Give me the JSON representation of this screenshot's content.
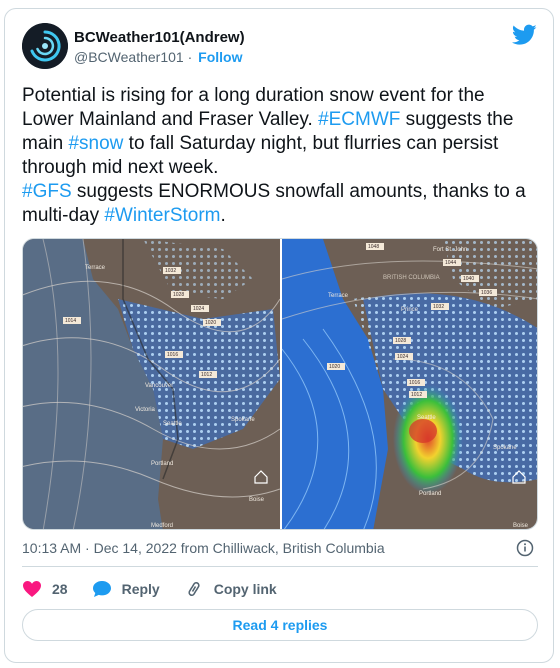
{
  "author": {
    "display_name": "BCWeather101(Andrew)",
    "handle": "@BCWeather101",
    "separator": "·",
    "follow_label": "Follow"
  },
  "tweet": {
    "p1_text": "Potential is rising for a long duration snow event for the Lower Mainland and Fraser Valley. ",
    "p1_tag1": "#ECMWF",
    "p1_mid": " suggests the main ",
    "p1_tag2": "#snow",
    "p1_end": " to fall Saturday night, but flurries can persist through mid next week.",
    "p2_tag1": "#GFS",
    "p2_mid": " suggests ENORMOUS snowfall amounts, thanks to a multi-day ",
    "p2_tag2": "#WinterStorm",
    "p2_end": "."
  },
  "maps": {
    "left_labels": [
      "Terrace",
      "Seattle",
      "Vancouver",
      "Victoria",
      "Portland",
      "Spokane",
      "Medford",
      "Boise"
    ],
    "right_labels": [
      "Fort St. John",
      "BRITISH COLUMBIA",
      "Terrace",
      "Prince",
      "Seattle",
      "Portland",
      "Spokane",
      "Boise"
    ],
    "left_isobars": [
      "1032",
      "1028",
      "1024",
      "1020",
      "1016",
      "1012",
      "1014"
    ],
    "right_isobars": [
      "1048",
      "1044",
      "1040",
      "1036",
      "1032",
      "1028",
      "1024",
      "1020",
      "1016",
      "1012"
    ]
  },
  "meta": {
    "time": "10:13 AM",
    "dot": "·",
    "date_source": "Dec 14, 2022 from Chilliwack, British Columbia"
  },
  "actions": {
    "like_count": "28",
    "reply_label": "Reply",
    "copy_link_label": "Copy link"
  },
  "read_replies_label": "Read 4 replies",
  "colors": {
    "link_blue": "#1d9bf0",
    "like_pink": "#f91880",
    "text_gray": "#536471",
    "border": "#cfd9de"
  }
}
